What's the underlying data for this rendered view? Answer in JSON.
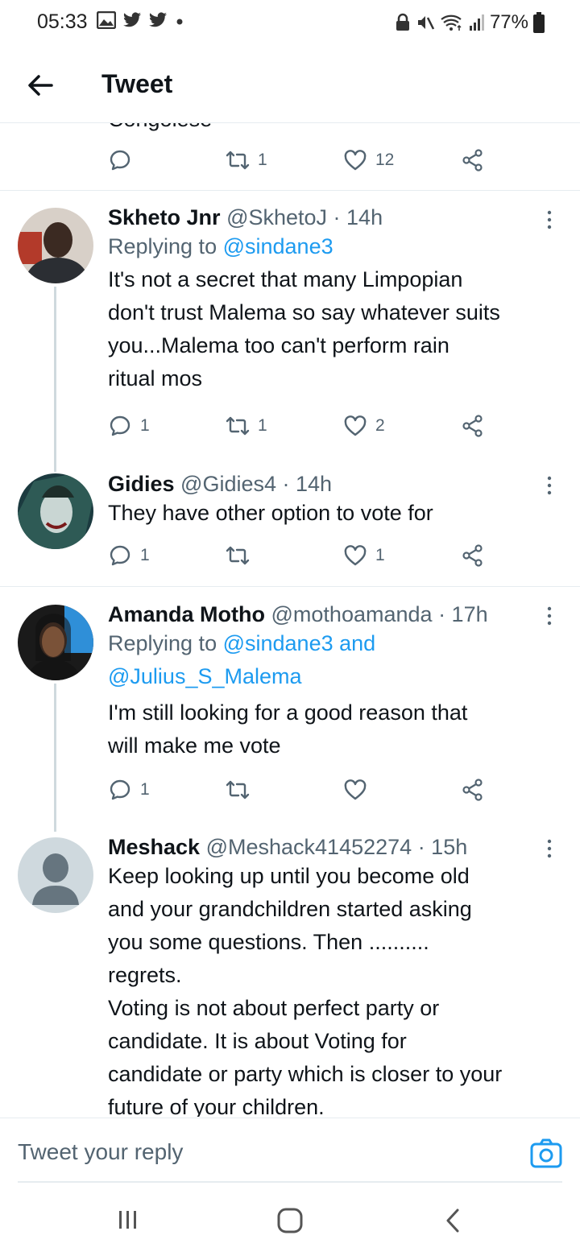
{
  "status_bar": {
    "time": "05:33",
    "battery": "77%",
    "left_icons": [
      "gallery-icon",
      "twitter-icon",
      "twitter-icon",
      "dot-icon"
    ],
    "right_icons": [
      "lock-icon",
      "mute-icon",
      "wifi-icon",
      "signal-icon",
      "battery-icon"
    ]
  },
  "header": {
    "title": "Tweet",
    "back_icon": "arrow-left-icon"
  },
  "top_tweet": {
    "cutoff_text": "Congolese",
    "actions": {
      "reply": "",
      "retweet": "1",
      "like": "12"
    }
  },
  "tweets": [
    {
      "name": "Skheto Jnr",
      "handle": "@SkhetoJ",
      "time": "· 14h",
      "replying_prefix": "Replying to ",
      "replying_to": "@sindane3",
      "body": "It's not a secret that many Limpopian\ndon't trust Malema so say whatever suits\nyou...Malema too can't perform rain\nritual mos",
      "actions": {
        "reply": "1",
        "retweet": "1",
        "like": "2"
      }
    },
    {
      "name": "Gidies",
      "handle": "@Gidies4",
      "time": "· 14h",
      "body": "They have other option to vote for",
      "actions": {
        "reply": "1",
        "retweet": "",
        "like": "1"
      }
    },
    {
      "name": "Amanda Motho",
      "handle": "@mothoamanda",
      "time": "· 17h",
      "replying_prefix": "Replying to ",
      "replying_to_line1": "@sindane3 and",
      "replying_to_line2": "@Julius_S_Malema",
      "body": "I'm still looking for a good reason that\nwill make me vote",
      "actions": {
        "reply": "1",
        "retweet": "",
        "like": ""
      }
    },
    {
      "name": "Meshack",
      "handle": "@Meshack41452274",
      "time": "· 15h",
      "body": "Keep looking up until you become old\nand your grandchildren started asking\nyou some questions. Then ..........\nregrets.\nVoting is not about perfect party or\ncandidate. It is about Voting for\ncandidate or party which is closer to your\nfuture of your children."
    }
  ],
  "reply_bar": {
    "placeholder": "Tweet your reply",
    "camera_icon": "camera-icon"
  },
  "nav_bar": {
    "icons": [
      "recent-apps-icon",
      "home-icon",
      "back-icon"
    ]
  },
  "colors": {
    "link": "#1d9bf0",
    "secondary": "#536471",
    "text": "#0f1419"
  }
}
